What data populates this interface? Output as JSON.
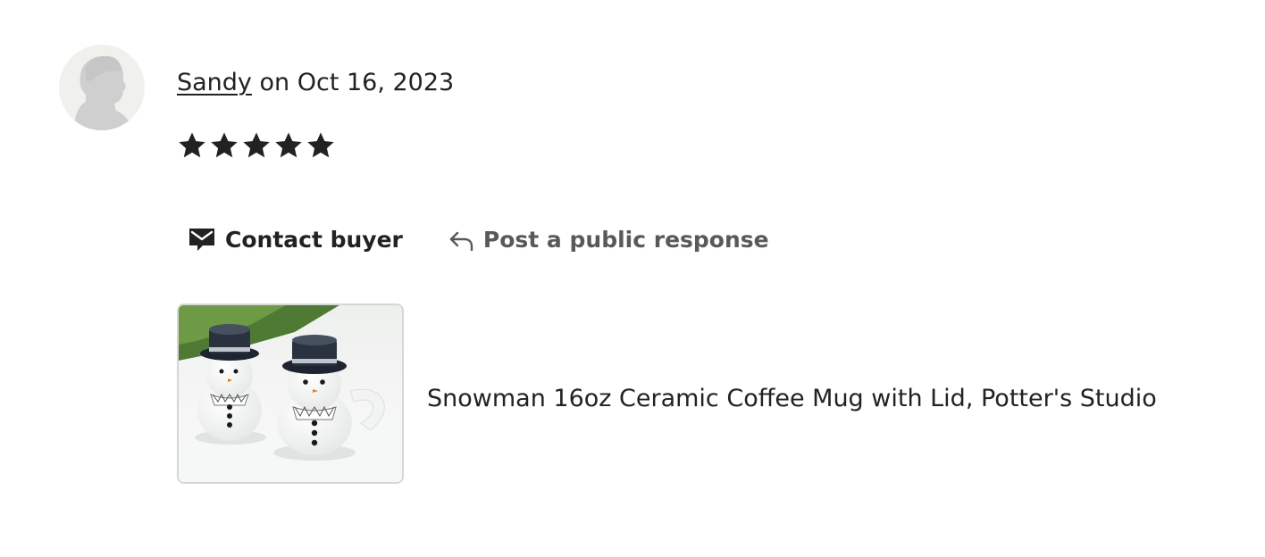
{
  "review": {
    "reviewer_name": "Sandy",
    "date_text": " on Oct 16, 2023",
    "rating": 5,
    "rating_max": 5
  },
  "actions": {
    "contact_label": "Contact buyer",
    "respond_label": "Post a public response"
  },
  "product": {
    "title": "Snowman 16oz Ceramic Coffee Mug with Lid, Potter's Studio"
  },
  "icons": {
    "avatar": "default-profile-silhouette",
    "star": "filled-star-icon",
    "contact": "message-envelope-icon",
    "respond": "reply-arrow-icon"
  },
  "colors": {
    "text": "#222222",
    "muted": "#595959",
    "star": "#222222",
    "avatar_bg": "#f0f0ec",
    "avatar_silhouette": "#cfcfcf"
  }
}
